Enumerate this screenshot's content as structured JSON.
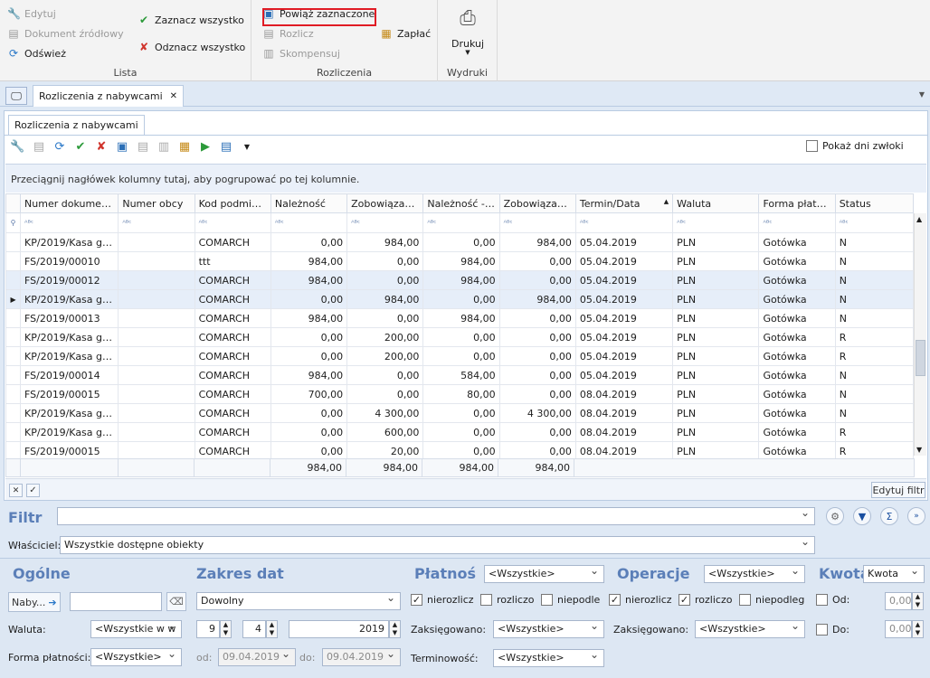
{
  "ribbon": {
    "lista": {
      "label": "Lista",
      "edit": "Edytuj",
      "source_doc": "Dokument źródłowy",
      "refresh": "Odśwież",
      "select_all": "Zaznacz wszystko",
      "deselect_all": "Odznacz wszystko"
    },
    "rozliczenia": {
      "label": "Rozliczenia",
      "link_selected": "Powiąż zaznaczone",
      "settle": "Rozlicz",
      "compensate": "Skompensuj",
      "pay": "Zapłać"
    },
    "wydruki": {
      "label": "Wydruki",
      "print": "Drukuj"
    }
  },
  "tabs": {
    "doc_tab": "Rozliczenia z nabywcami",
    "sub_tab": "Rozliczenia z nabywcami"
  },
  "toolbar": {
    "show_delay_days": "Pokaż dni zwłoki"
  },
  "grid": {
    "group_hint": "Przeciągnij nagłówek kolumny tutaj, aby pogrupować po tej kolumnie.",
    "columns": [
      "Numer dokumentu",
      "Numer obcy",
      "Kod podmiotu",
      "Należność",
      "Zobowiązanie",
      "Należność - ...",
      "Zobowiązani...",
      "Termin/Data",
      "Waluta",
      "Forma płatn...",
      "Status"
    ],
    "filter_hint": "ᴬᴮᶜ",
    "rows": [
      [
        "KP/2019/Kasa got...",
        "",
        "COMARCH",
        "0,00",
        "984,00",
        "0,00",
        "984,00",
        "05.04.2019",
        "PLN",
        "Gotówka",
        "N"
      ],
      [
        "FS/2019/00010",
        "",
        "ttt",
        "984,00",
        "0,00",
        "984,00",
        "0,00",
        "05.04.2019",
        "PLN",
        "Gotówka",
        "N"
      ],
      [
        "FS/2019/00012",
        "",
        "COMARCH",
        "984,00",
        "0,00",
        "984,00",
        "0,00",
        "05.04.2019",
        "PLN",
        "Gotówka",
        "N"
      ],
      [
        "KP/2019/Kasa got...",
        "",
        "COMARCH",
        "0,00",
        "984,00",
        "0,00",
        "984,00",
        "05.04.2019",
        "PLN",
        "Gotówka",
        "N"
      ],
      [
        "FS/2019/00013",
        "",
        "COMARCH",
        "984,00",
        "0,00",
        "984,00",
        "0,00",
        "05.04.2019",
        "PLN",
        "Gotówka",
        "N"
      ],
      [
        "KP/2019/Kasa got...",
        "",
        "COMARCH",
        "0,00",
        "200,00",
        "0,00",
        "0,00",
        "05.04.2019",
        "PLN",
        "Gotówka",
        "R"
      ],
      [
        "KP/2019/Kasa got...",
        "",
        "COMARCH",
        "0,00",
        "200,00",
        "0,00",
        "0,00",
        "05.04.2019",
        "PLN",
        "Gotówka",
        "R"
      ],
      [
        "FS/2019/00014",
        "",
        "COMARCH",
        "984,00",
        "0,00",
        "584,00",
        "0,00",
        "05.04.2019",
        "PLN",
        "Gotówka",
        "N"
      ],
      [
        "FS/2019/00015",
        "",
        "COMARCH",
        "700,00",
        "0,00",
        "80,00",
        "0,00",
        "08.04.2019",
        "PLN",
        "Gotówka",
        "N"
      ],
      [
        "KP/2019/Kasa got...",
        "",
        "COMARCH",
        "0,00",
        "4 300,00",
        "0,00",
        "4 300,00",
        "08.04.2019",
        "PLN",
        "Gotówka",
        "N"
      ],
      [
        "KP/2019/Kasa got...",
        "",
        "COMARCH",
        "0,00",
        "600,00",
        "0,00",
        "0,00",
        "08.04.2019",
        "PLN",
        "Gotówka",
        "R"
      ],
      [
        "FS/2019/00015",
        "",
        "COMARCH",
        "0,00",
        "20,00",
        "0,00",
        "0,00",
        "08.04.2019",
        "PLN",
        "Gotówka",
        "R"
      ]
    ],
    "totals": [
      "984,00",
      "984,00",
      "984,00",
      "984,00"
    ],
    "edit_filter": "Edytuj filtr"
  },
  "filter": {
    "label": "Filtr",
    "value": "",
    "owners_label": "Właściciel:",
    "owners_value": "Wszystkie dostępne obiekty"
  },
  "ogolne": {
    "title": "Ogólne",
    "naby_btn": "Naby...",
    "waluta_label": "Waluta:",
    "waluta_value": "<Wszystkie w w",
    "forma_label": "Forma płatności:",
    "forma_value": "<Wszystkie>"
  },
  "zakres": {
    "title": "Zakres dat",
    "mode": "Dowolny",
    "day": "9",
    "month": "4",
    "year": "2019",
    "od_label": "od:",
    "od_value": "09.04.2019",
    "do_label": "do:",
    "do_value": "09.04.2019"
  },
  "platnosci": {
    "title": "Płatność",
    "value": "<Wszystkie>",
    "nierozlicz": "nierozlicz",
    "rozliczo": "rozliczo",
    "niepodle": "niepodle",
    "zaks_label": "Zaksięgowano:",
    "zaks_value": "<Wszystkie>",
    "term_label": "Terminowość:",
    "term_value": "<Wszystkie>"
  },
  "operacje": {
    "title": "Operacje",
    "value": "<Wszystkie>",
    "nierozlicz": "nierozlicz",
    "rozliczo": "rozliczo",
    "niepodleg": "niepodleg",
    "zaks_label": "Zaksięgowano:",
    "zaks_value": "<Wszystkie>"
  },
  "kwota": {
    "title": "Kwota",
    "value": "Kwota",
    "od_label": "Od:",
    "od_value": "0,00",
    "do_label": "Do:",
    "do_value": "0,00"
  }
}
